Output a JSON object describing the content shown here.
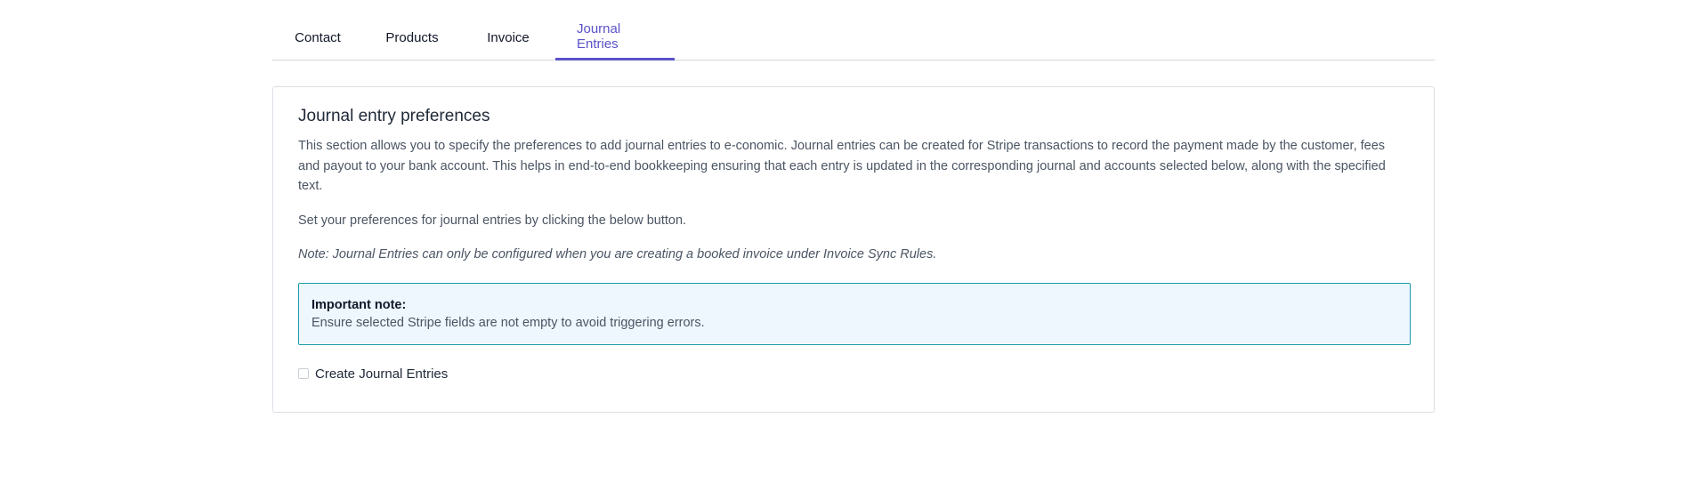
{
  "tabs": [
    {
      "label": "Contact",
      "active": false
    },
    {
      "label": "Products",
      "active": false
    },
    {
      "label": "Invoice",
      "active": false
    },
    {
      "label": "Journal Entries",
      "active": true
    }
  ],
  "section": {
    "title": "Journal entry preferences",
    "description": "This section allows you to specify the preferences to add journal entries to e-conomic. Journal entries can be created for Stripe transactions to record the payment made by the customer, fees and payout to your bank account. This helps in end-to-end bookkeeping ensuring that each entry is updated in the corresponding journal and accounts selected below, along with the specified text.",
    "instruction": "Set your preferences for journal entries by clicking the below button.",
    "note": "Note: Journal Entries can only be configured when you are creating a booked invoice under Invoice Sync Rules."
  },
  "alert": {
    "title": "Important note:",
    "text": "Ensure selected Stripe fields are not empty to avoid triggering errors."
  },
  "checkbox": {
    "label": "Create Journal Entries",
    "checked": false
  },
  "colors": {
    "accent": "#5a52c9",
    "alert_border": "#1b9ba8",
    "alert_bg": "#eef6fe"
  }
}
